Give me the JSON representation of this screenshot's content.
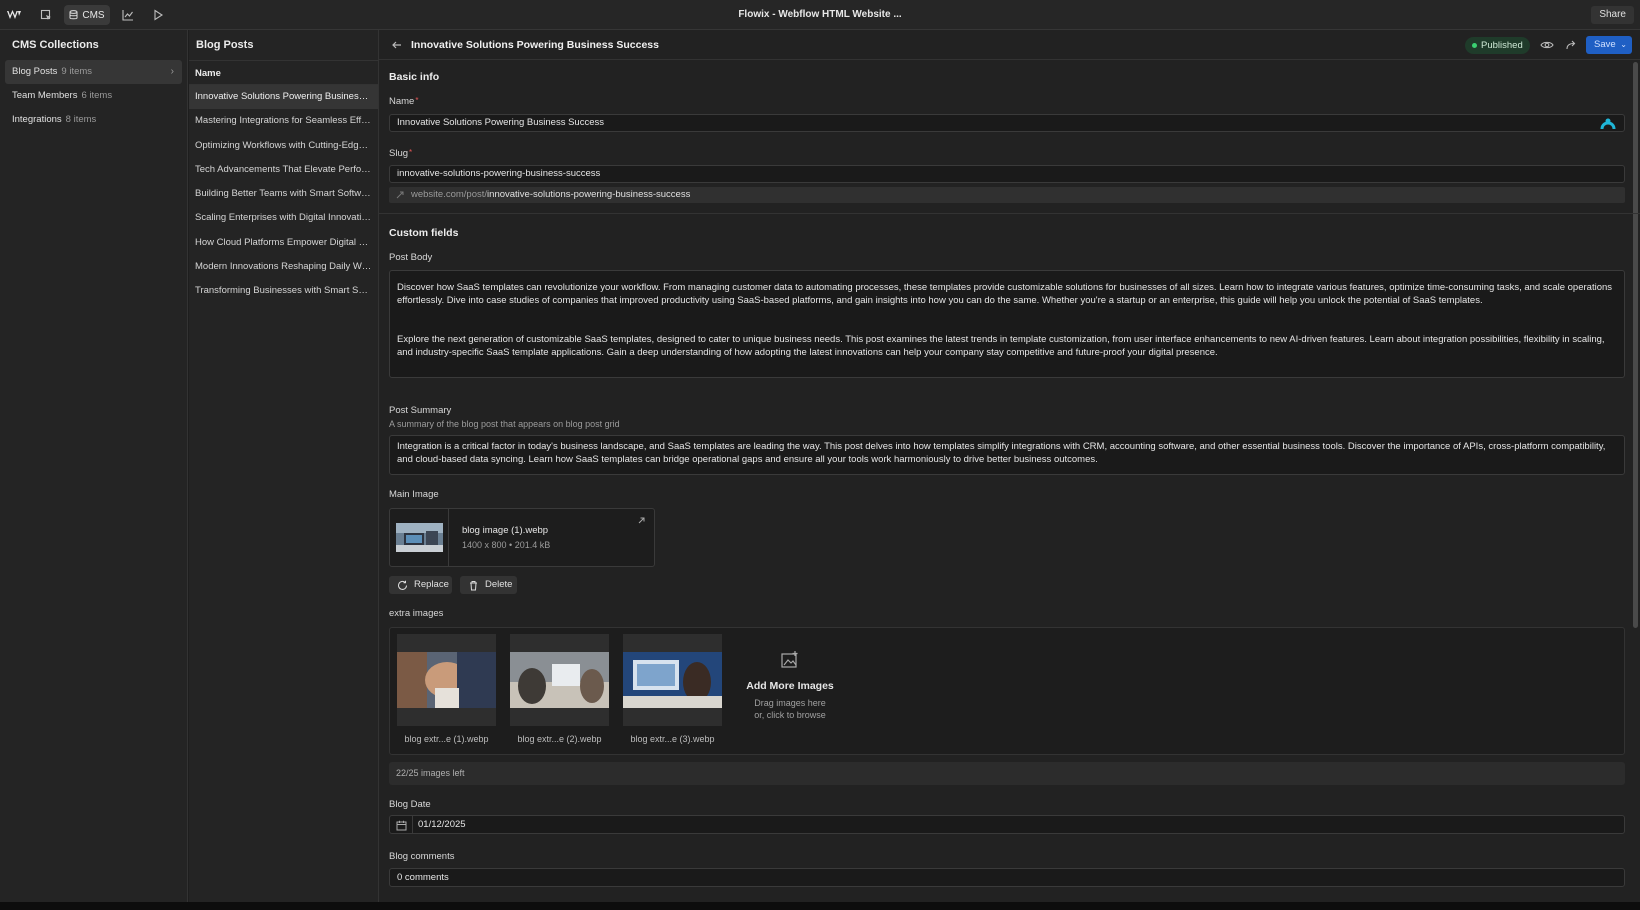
{
  "window": {
    "title": "Flowix - Webflow HTML Website ...",
    "share_label": "Share"
  },
  "toolbar": {
    "cms_label": "CMS",
    "icons": [
      "webflow-logo",
      "pages-icon",
      "cms-database-icon",
      "analytics-icon",
      "play-icon"
    ]
  },
  "collections": {
    "heading": "CMS Collections",
    "items": [
      {
        "label": "Blog Posts",
        "count": "9 items"
      },
      {
        "label": "Team Members",
        "count": "6 items"
      },
      {
        "label": "Integrations",
        "count": "8 items"
      }
    ]
  },
  "posts": {
    "heading": "Blog Posts",
    "column_header": "Name",
    "rows": [
      "Innovative Solutions Powering Business Success",
      "Mastering Integrations for Seamless Efficiency",
      "Optimizing Workflows with Cutting-Edge Tools",
      "Tech Advancements That Elevate Performance",
      "Building Better Teams with Smart Software",
      "Scaling Enterprises with Digital Innovations",
      "How Cloud Platforms Empower Digital Success",
      "Modern Innovations Reshaping Daily Work",
      "Transforming Businesses with Smart Solutions"
    ]
  },
  "editor": {
    "title": "Innovative Solutions Powering Business Success",
    "status": "Published",
    "save_label": "Save",
    "basic_info_heading": "Basic info",
    "name_label": "Name",
    "name_value": "Innovative Solutions Powering Business Success",
    "slug_label": "Slug",
    "slug_value": "innovative-solutions-powering-business-success",
    "url_prefix": "website.com/post/",
    "url_slug": "innovative-solutions-powering-business-success",
    "custom_fields_heading": "Custom fields",
    "post_body_label": "Post Body",
    "post_body_p1": "Discover how SaaS templates can revolutionize your workflow. From managing customer data to automating processes, these templates provide customizable solutions for businesses of all sizes. Learn how to integrate various features, optimize time-consuming tasks, and scale operations effortlessly. Dive into case studies of companies that improved productivity using SaaS-based platforms, and gain insights into how you can do the same. Whether you're a startup or an enterprise, this guide will help you unlock the potential of SaaS templates.",
    "post_body_p2": "Explore the next generation of customizable SaaS templates, designed to cater to unique business needs. This post examines the latest trends in template customization, from user interface enhancements to new AI-driven features. Learn about integration possibilities, flexibility in scaling, and industry-specific SaaS template applications. Gain a deep understanding of how adopting the latest innovations can help your company stay competitive and future-proof your digital presence.",
    "post_summary_label": "Post Summary",
    "post_summary_hint": "A summary of the blog post that appears on blog post grid",
    "post_summary_value": "Integration is a critical factor in today's business landscape, and SaaS templates are leading the way. This post delves into how templates simplify integrations with CRM, accounting software, and other essential business tools. Discover the importance of APIs, cross-platform compatibility, and cloud-based data syncing. Learn how SaaS templates can bridge operational gaps and ensure all your tools work harmoniously to drive better business outcomes.",
    "main_image_label": "Main Image",
    "main_image_name": "blog image (1).webp",
    "main_image_meta": "1400 x 800 • 201.4 kB",
    "replace_label": "Replace",
    "delete_label": "Delete",
    "extra_images_label": "extra images",
    "extra_images": [
      "blog extr...e (1).webp",
      "blog extr...e (2).webp",
      "blog extr...e (3).webp"
    ],
    "add_more_title": "Add More Images",
    "add_more_line1": "Drag images here",
    "add_more_line2": "or, click to browse",
    "images_left": "22/25 images left",
    "blog_date_label": "Blog Date",
    "blog_date_value": "01/12/2025",
    "blog_comments_label": "Blog comments",
    "blog_comments_value": "0 comments"
  },
  "colors": {
    "accent": "#1f5fc4",
    "published_dot": "#3ad071",
    "required": "#e05555"
  }
}
